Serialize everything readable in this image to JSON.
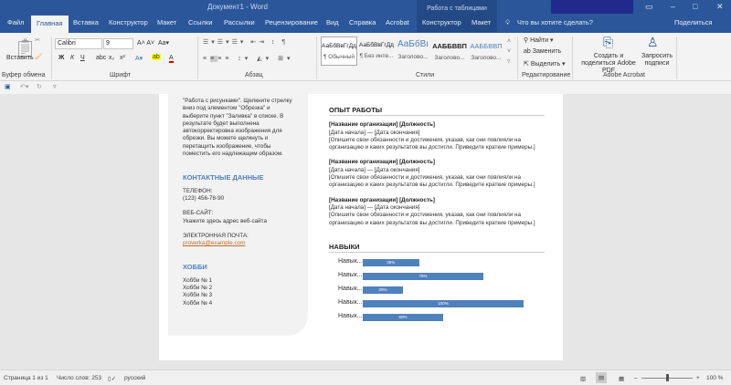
{
  "window": {
    "title": "Документ1 - Word",
    "context_tab_group": "Работа с таблицами"
  },
  "tabs": [
    "Файл",
    "Главная",
    "Вставка",
    "Конструктор",
    "Макет",
    "Ссылки",
    "Рассылки",
    "Рецензирование",
    "Вид",
    "Справка",
    "Acrobat",
    "Конструктор",
    "Макет"
  ],
  "tell_me": "Что вы хотите сделать?",
  "share": "Поделиться",
  "ribbon": {
    "clipboard": {
      "paste": "Вставить",
      "group": "Буфер обмена"
    },
    "font": {
      "name": "Calibri",
      "size": "9",
      "group": "Шрифт",
      "buttons": [
        "Ж",
        "К",
        "Ч",
        "abc",
        "x₂",
        "x²"
      ]
    },
    "paragraph": {
      "group": "Абзац"
    },
    "styles": {
      "group": "Стили",
      "items": [
        {
          "preview": "АаБбВвГгДд",
          "name": "¶ Обычный"
        },
        {
          "preview": "АаБбВвГгДд",
          "name": "¶ Без инте..."
        },
        {
          "preview": "АаБбВı",
          "name": "Заголово..."
        },
        {
          "preview": "ААББВВП",
          "name": "Заголово..."
        },
        {
          "preview": "ААББВВП",
          "name": "Заголово..."
        }
      ]
    },
    "editing": {
      "find": "Найти",
      "replace": "Заменить",
      "select": "Выделить",
      "group": "Редактирование"
    },
    "acrobat": {
      "create": "Создать и поделиться Adobe PDF",
      "request": "Запросить подписи",
      "group": "Adobe Acrobat"
    }
  },
  "document": {
    "left": {
      "intro": "\"Работа с рисунками\". Щелкните стрелку вниз под элементом \"Обрезка\" и выберите пункт \"Заливка\" в списке. В результате будет выполнена автокорректировка изображения для обрезки. Вы можете щелкнуть и перетащить изображение, чтобы поместить его надлежащим образом.",
      "contacts_title": "КОНТАКТНЫЕ ДАННЫЕ",
      "phone_label": "ТЕЛЕФОН:",
      "phone": "(123) 456-78-90",
      "web_label": "ВЕБ-САЙТ:",
      "web": "Укажите здесь адрес веб-сайта",
      "email_label": "ЭЛЕКТРОННАЯ ПОЧТА:",
      "email": "proverka@example.com",
      "hobby_title": "ХОББИ",
      "hobbies": [
        "Хобби № 1",
        "Хобби № 2",
        "Хобби № 3",
        "Хобби № 4"
      ]
    },
    "experience_title": "ОПЫТ РАБОТЫ",
    "jobs": [
      {
        "title": "[Название организации] [Должность]",
        "dates": "[Дата начала] — [Дата окончания]",
        "desc": "[Опишите свои обязанности и достижения, указав, как они повлияли на организацию и каких результатов вы достигли. Приведите краткие примеры.]"
      },
      {
        "title": "[Название организации] [Должность]",
        "dates": "[Дата начала] — [Дата окончания]",
        "desc": "[Опишите свои обязанности и достижения, указав, как они повлияли на организацию и каких результатов вы достигли. Приведите краткие примеры.]"
      },
      {
        "title": "[Название организации] [Должность]",
        "dates": "[Дата начала] — [Дата окончания]",
        "desc": "[Опишите свои обязанности и достижения, указав, как они повлияли на организацию и каких результатов вы достигли. Приведите краткие примеры.]"
      }
    ],
    "skills_title": "НАВЫКИ",
    "skills": [
      {
        "label": "Навык...",
        "value": 35,
        "text": "35%"
      },
      {
        "label": "Навык...",
        "value": 75,
        "text": "75%"
      },
      {
        "label": "Навык...",
        "value": 25,
        "text": "25%"
      },
      {
        "label": "Навык...",
        "value": 100,
        "text": "100%"
      },
      {
        "label": "Навык...",
        "value": 50,
        "text": "50%"
      }
    ]
  },
  "status": {
    "page": "Страница 1 из 1",
    "words": "Число слов: 253",
    "language": "русский",
    "zoom": "100 %",
    "zoom_value": 100
  }
}
